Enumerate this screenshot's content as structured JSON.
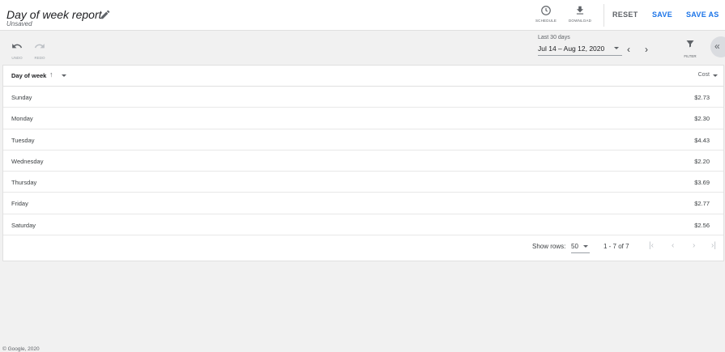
{
  "header": {
    "title": "Day of week report",
    "subtitle": "Unsaved",
    "schedule_label": "SCHEDULE",
    "download_label": "DOWNLOAD",
    "reset_label": "RESET",
    "save_label": "SAVE",
    "save_as_label": "SAVE AS"
  },
  "toolbar": {
    "undo_label": "UNDO",
    "redo_label": "REDO",
    "date_label": "Last 30 days",
    "date_range": "Jul 14 – Aug 12, 2020",
    "filter_label": "FILTER"
  },
  "table": {
    "columns": {
      "day": "Day of week",
      "cost": "Cost"
    },
    "rows": [
      {
        "day": "Sunday",
        "cost": "$2.73"
      },
      {
        "day": "Monday",
        "cost": "$2.30"
      },
      {
        "day": "Tuesday",
        "cost": "$4.43"
      },
      {
        "day": "Wednesday",
        "cost": "$2.20"
      },
      {
        "day": "Thursday",
        "cost": "$3.69"
      },
      {
        "day": "Friday",
        "cost": "$2.77"
      },
      {
        "day": "Saturday",
        "cost": "$2.56"
      }
    ],
    "pagination": {
      "show_rows_label": "Show rows:",
      "rows_value": "50",
      "range": "1 - 7 of 7"
    }
  },
  "footer": {
    "copyright": "© Google, 2020"
  },
  "colors": {
    "accent": "#1a73e8",
    "text": "#202124",
    "muted": "#5f6368"
  }
}
